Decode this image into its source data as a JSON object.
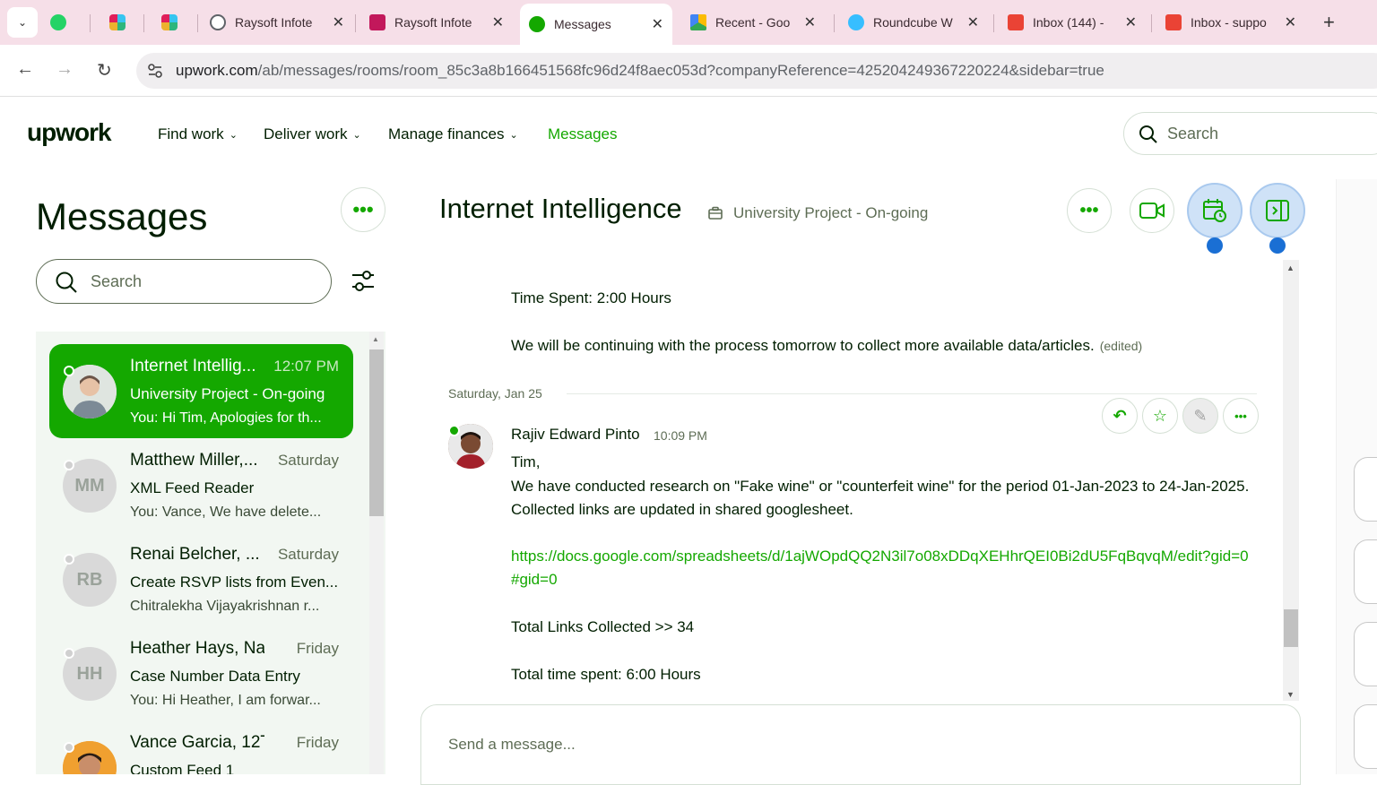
{
  "browser": {
    "tabs": [
      {
        "label": "",
        "icon": "whatsapp-icon",
        "color": "#25d366"
      },
      {
        "label": "",
        "icon": "slack-icon",
        "color": "#e01e5a"
      },
      {
        "label": "",
        "icon": "slack-icon",
        "color": "#e01e5a"
      },
      {
        "label": "Raysoft Infote",
        "icon": "globe-icon",
        "color": "#5f6368"
      },
      {
        "label": "Raysoft Infote",
        "icon": "graduation-cap-icon",
        "color": "#c2185b"
      },
      {
        "label": "Messages",
        "icon": "upwork-icon",
        "color": "#14a800",
        "active": true
      },
      {
        "label": "Recent - Goo",
        "icon": "google-drive-icon",
        "color": "#fbbc04"
      },
      {
        "label": "Roundcube W",
        "icon": "roundcube-icon",
        "color": "#37beff"
      },
      {
        "label": "Inbox (144) -",
        "icon": "gmail-icon",
        "color": "#ea4335"
      },
      {
        "label": "Inbox - suppo",
        "icon": "gmail-icon",
        "color": "#ea4335"
      }
    ],
    "url_host": "upwork.com",
    "url_rest": "/ab/messages/rooms/room_85c3a8b166451568fc96d24f8aec053d?companyReference=425204249367220224&sidebar=true"
  },
  "header": {
    "logo": "upwork",
    "nav": [
      "Find work",
      "Deliver work",
      "Manage finances",
      "Messages"
    ],
    "search_placeholder": "Search"
  },
  "sidebar": {
    "title": "Messages",
    "search_placeholder": "Search",
    "rooms": [
      {
        "name": "Internet Intellig...",
        "time": "12:07 PM",
        "subtitle": "University Project - On-going",
        "preview": "You: Hi Tim, Apologies for th...",
        "initials": "",
        "active": true
      },
      {
        "name": "Matthew Miller,...",
        "time": "Saturday",
        "subtitle": "XML Feed Reader",
        "preview": "You: Vance, We have delete...",
        "initials": "MM"
      },
      {
        "name": "Renai Belcher, ...",
        "time": "Saturday",
        "subtitle": "Create RSVP lists from Even...",
        "preview": "Chitralekha Vijayakrishnan r...",
        "initials": "RB"
      },
      {
        "name": "Heather Hays, Na...",
        "time": "Friday",
        "subtitle": "Case Number Data Entry",
        "preview": "You: Hi Heather, I am forwar...",
        "initials": "HH"
      },
      {
        "name": "Vance Garcia, 12T...",
        "time": "Friday",
        "subtitle": "Custom Feed 1",
        "preview": "",
        "initials": ""
      }
    ]
  },
  "conversation": {
    "title": "Internet Intelligence",
    "contract": "University Project - On-going",
    "prev_line_1": "Time Spent: 2:00 Hours",
    "prev_line_2": "We will be continuing with the process tomorrow to collect more available data/articles.",
    "edited": "(edited)",
    "date_separator": "Saturday, Jan 25",
    "sender": "Rajiv Edward Pinto",
    "sent_time": "10:09 PM",
    "greeting": "Tim,",
    "body_1": "We have conducted research on \"Fake wine\" or \"counterfeit wine\" for the period 01-Jan-2023 to 24-Jan-2025. Collected links are updated in shared googlesheet.",
    "link": "https://docs.google.com/spreadsheets/d/1ajWOpdQQ2N3il7o08xDDqXEHhrQEI0Bi2dU5FqBqvqM/edit?gid=0#gid=0",
    "total_links": "Total Links Collected >> 34",
    "total_time": "Total time spent: 6:00 Hours",
    "composer_placeholder": "Send a message..."
  },
  "colors": {
    "brand_green": "#14a800",
    "highlight_blue": "#1a6fd4"
  }
}
